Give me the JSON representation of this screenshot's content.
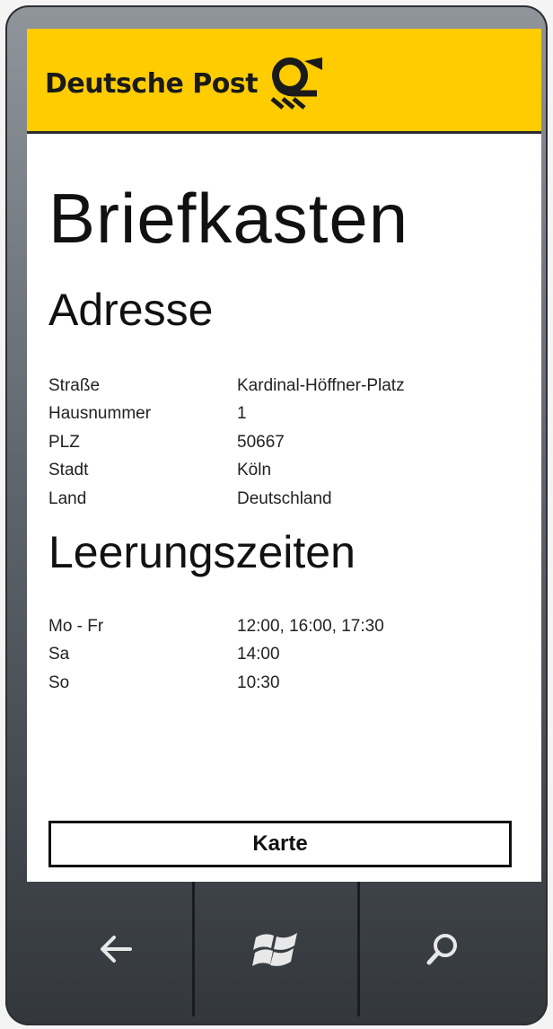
{
  "brand": {
    "name": "Deutsche Post"
  },
  "page": {
    "title": "Briefkasten"
  },
  "address": {
    "heading": "Adresse",
    "rows": [
      {
        "label": "Straße",
        "value": "Kardinal-Höffner-Platz"
      },
      {
        "label": "Hausnummer",
        "value": "1"
      },
      {
        "label": "PLZ",
        "value": "50667"
      },
      {
        "label": "Stadt",
        "value": "Köln"
      },
      {
        "label": "Land",
        "value": "Deutschland"
      }
    ]
  },
  "collection": {
    "heading": "Leerungszeiten",
    "rows": [
      {
        "label": "Mo - Fr",
        "value": "12:00, 16:00, 17:30"
      },
      {
        "label": "Sa",
        "value": "14:00"
      },
      {
        "label": "So",
        "value": "10:30"
      }
    ]
  },
  "actions": {
    "map_label": "Karte"
  },
  "nav": {
    "back_icon": "back-arrow-icon",
    "start_icon": "windows-logo-icon",
    "search_icon": "search-icon"
  },
  "colors": {
    "brand_yellow": "#ffcc00"
  }
}
